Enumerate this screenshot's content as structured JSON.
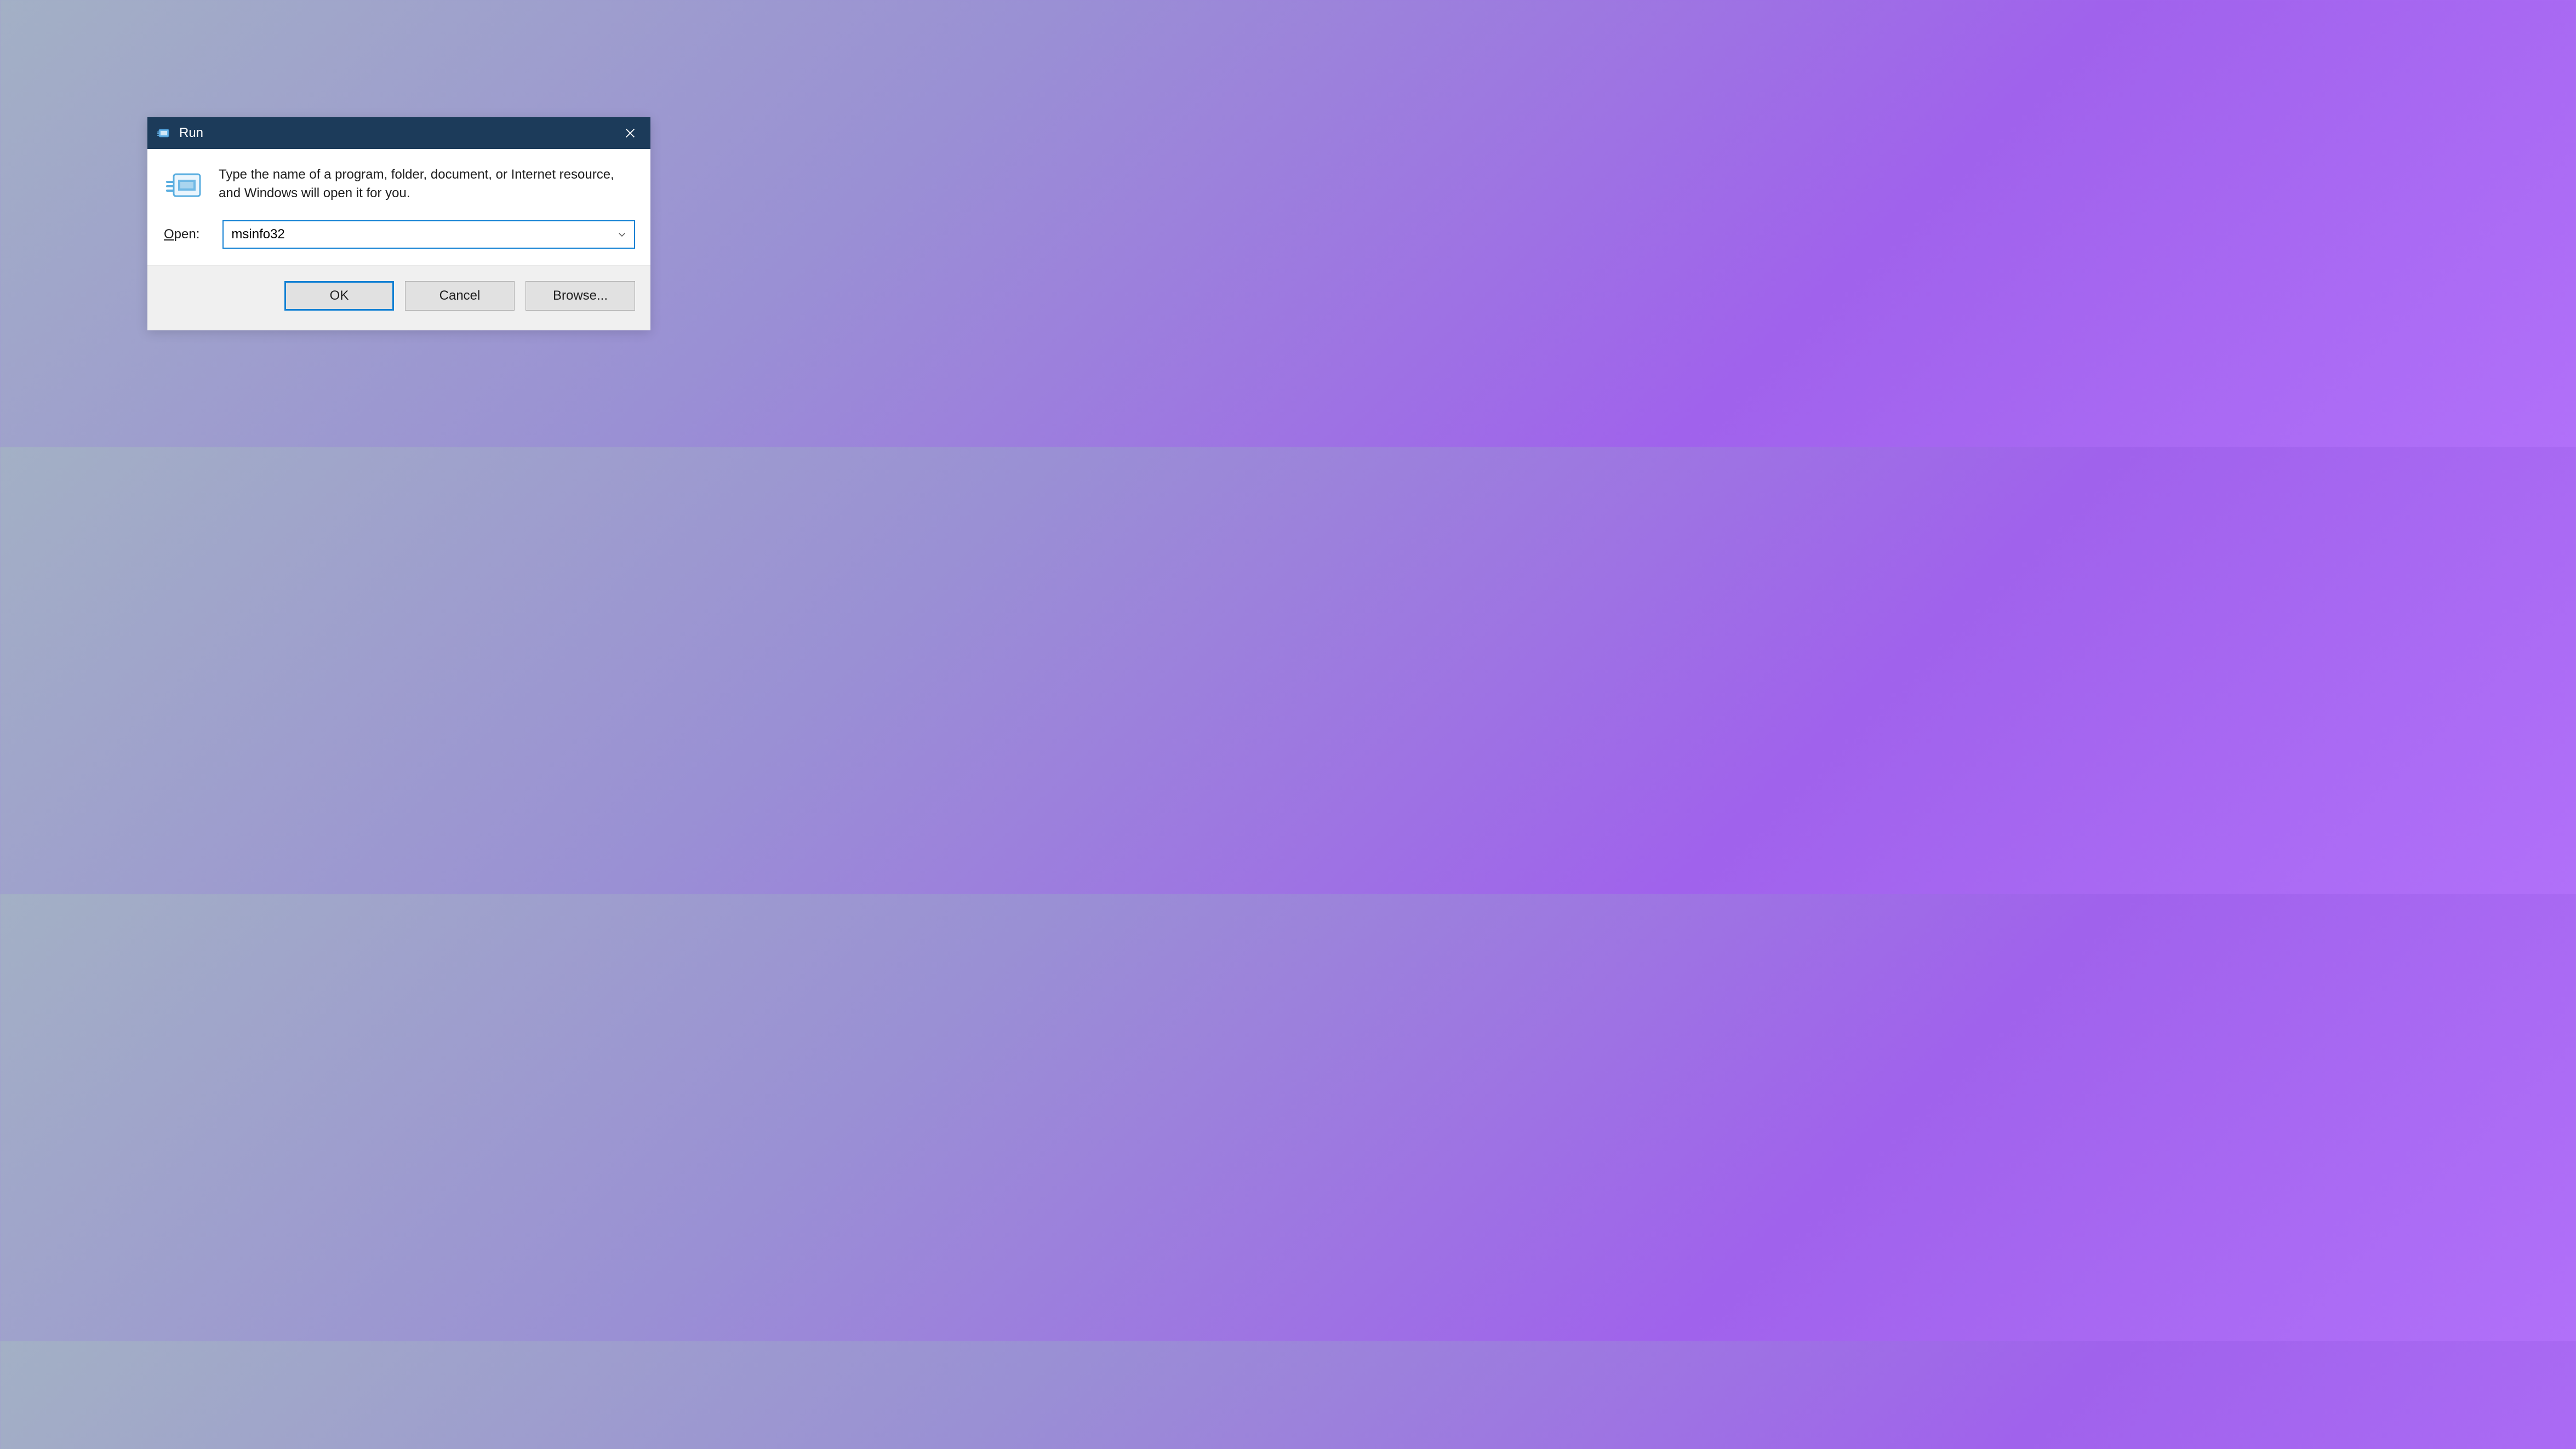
{
  "dialog": {
    "title": "Run",
    "description": "Type the name of a program, folder, document, or Internet resource, and Windows will open it for you.",
    "open_label_prefix": "O",
    "open_label_rest": "pen:",
    "input_value": "msinfo32",
    "buttons": {
      "ok": "OK",
      "cancel": "Cancel",
      "browse": "Browse..."
    }
  }
}
